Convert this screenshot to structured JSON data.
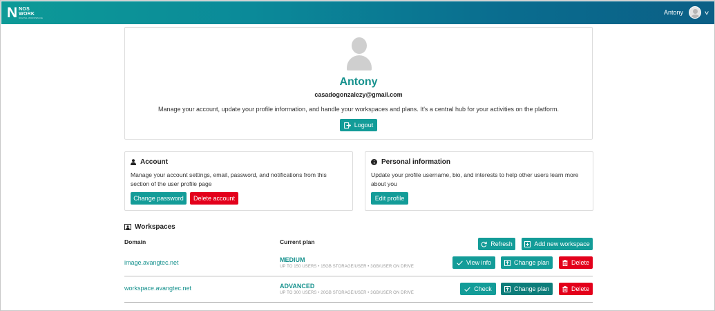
{
  "header": {
    "logo_letter": "N",
    "logo_line1": "NOS",
    "logo_line2": "WORK",
    "logo_tagline": "DIGITAL WORKSPACE",
    "user_name": "Antony"
  },
  "profile": {
    "name": "Antony",
    "email": "casadogonzalezy@gmail.com",
    "description": "Manage your account, update your profile information, and handle your workspaces and plans. It's a central hub for your activities on the platform.",
    "logout_label": "Logout"
  },
  "account": {
    "title": "Account",
    "description": "Manage your account settings, email, password, and notifications from this section of the user profile page",
    "change_password_label": "Change password",
    "delete_account_label": "Delete account"
  },
  "personal": {
    "title": "Personal information",
    "description": "Update your profile username, bio, and interests to help other users learn more about you",
    "edit_profile_label": "Edit profile"
  },
  "workspaces": {
    "title": "Workspaces",
    "col_domain": "Domain",
    "col_plan": "Current plan",
    "refresh_label": "Refresh",
    "add_label": "Add new workspace",
    "rows": [
      {
        "domain": "image.avangtec.net",
        "plan": "MEDIUM",
        "plan_desc": "UP TO 150 USERS • 15GB STORAGE/USER • 3GB/USER ON DRIVE",
        "primary_label": "View info",
        "change_plan_label": "Change plan",
        "delete_label": "Delete"
      },
      {
        "domain": "workspace.avangtec.net",
        "plan": "ADVANCED",
        "plan_desc": "UP TO 300 USERS • 20GB STORAGE/USER • 3GB/USER ON DRIVE",
        "primary_label": "Check",
        "change_plan_label": "Change plan",
        "delete_label": "Delete"
      }
    ]
  },
  "colors": {
    "accent": "#139c98",
    "accent_dark": "#0d7d7a",
    "danger": "#e3001b",
    "link": "#16918d"
  },
  "icons": {
    "logout": "logout-icon",
    "user": "user-icon",
    "info": "info-icon",
    "workspace": "workspace-icon",
    "refresh": "refresh-icon",
    "add": "plus-square-icon",
    "check": "check-icon",
    "upload": "upload-square-icon",
    "trash": "trash-icon",
    "chevron": "chevron-down-icon"
  }
}
